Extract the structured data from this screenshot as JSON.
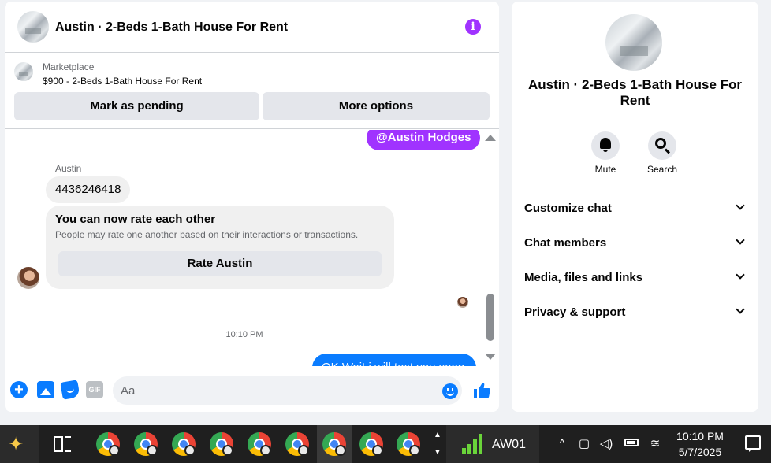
{
  "header": {
    "title": "Austin · 2-Beds 1-Bath House For Rent",
    "info_icon": "info-icon",
    "accent": "#a033ff"
  },
  "marketplace": {
    "label": "Marketplace",
    "listing": "$900 - 2-Beds 1-Bath House For Rent",
    "mark_pending": "Mark as pending",
    "more_options": "More options"
  },
  "messages": {
    "mention": "@Austin Hodges",
    "sender_name": "Austin",
    "phone": "4436246418",
    "rate_title": "You can now rate each other",
    "rate_desc": "People may rate one another based on their interactions or transactions.",
    "rate_button": "Rate Austin",
    "timestamp": "10:10 PM",
    "outgoing_partial": "OK Wait i will text you soon",
    "outgoing_color": "#0a7cff"
  },
  "composer": {
    "placeholder": "Aa",
    "gif_label": "GIF",
    "plus": "+"
  },
  "details": {
    "title": "Austin · 2-Beds 1-Bath House For Rent",
    "mute": "Mute",
    "search": "Search",
    "sections": [
      {
        "label": "Customize chat"
      },
      {
        "label": "Chat members"
      },
      {
        "label": "Media, files and links"
      },
      {
        "label": "Privacy & support"
      }
    ]
  },
  "taskbar": {
    "stock_label": "AW01",
    "time": "10:10 PM",
    "date": "5/7/2025"
  }
}
